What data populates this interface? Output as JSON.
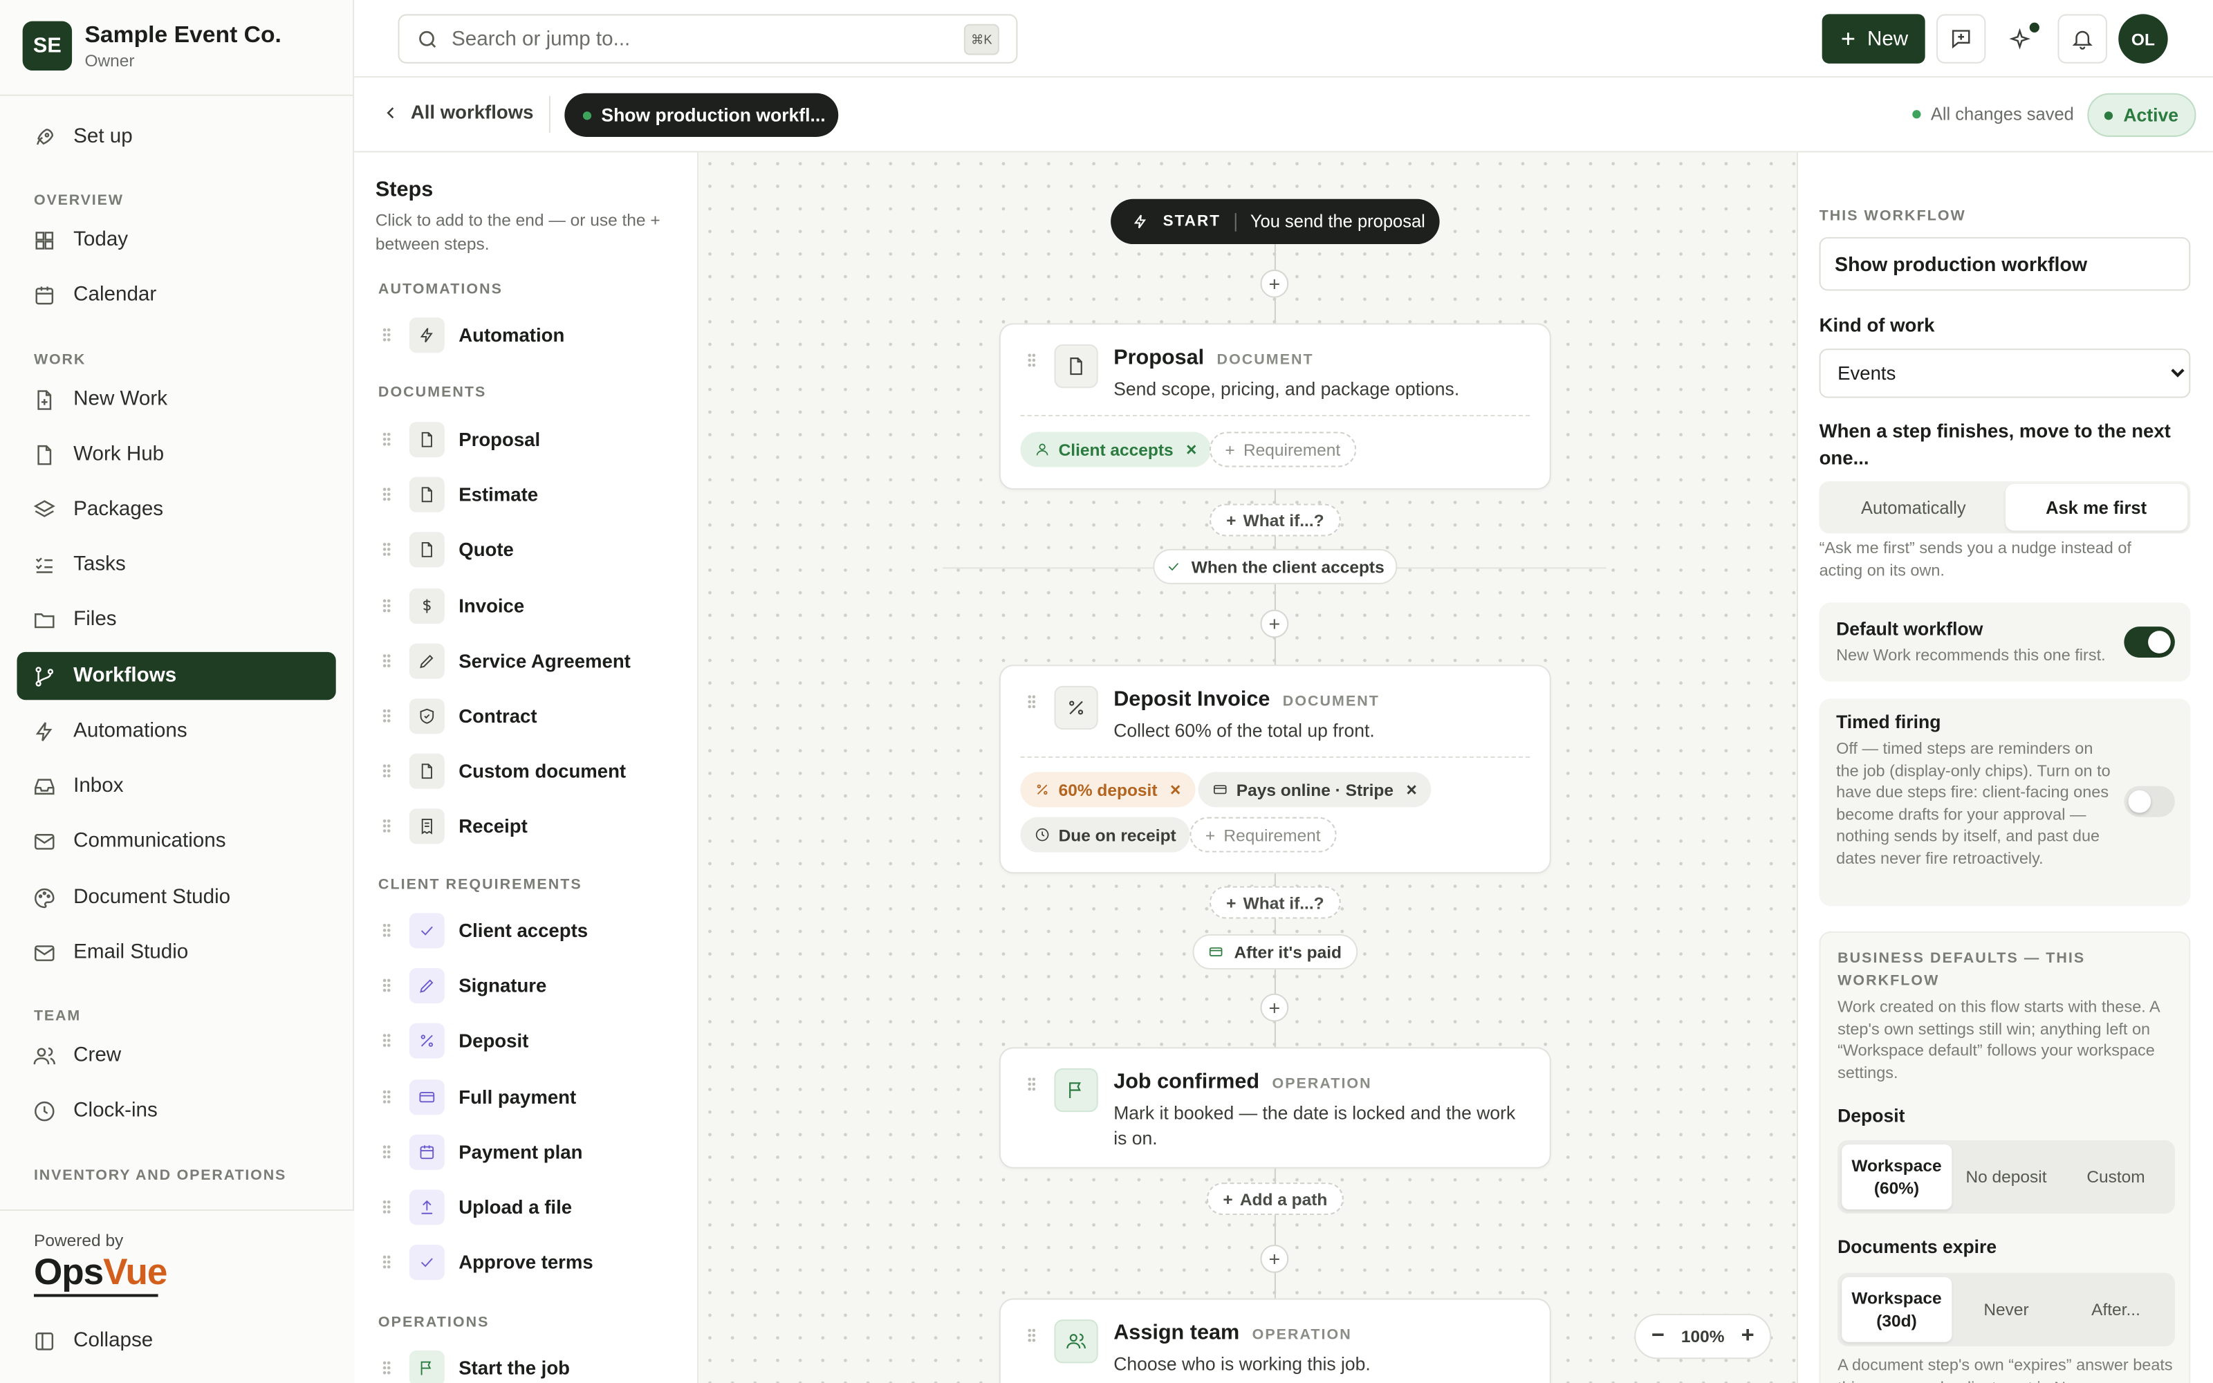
{
  "org": {
    "initials": "SE",
    "name": "Sample Event Co.",
    "role": "Owner"
  },
  "nav": {
    "setup": "Set up",
    "overview_title": "OVERVIEW",
    "today": "Today",
    "calendar": "Calendar",
    "work_title": "WORK",
    "new_work": "New Work",
    "work_hub": "Work Hub",
    "packages": "Packages",
    "tasks": "Tasks",
    "files": "Files",
    "workflows": "Workflows",
    "automations": "Automations",
    "inbox": "Inbox",
    "communications": "Communications",
    "document_studio": "Document Studio",
    "email_studio": "Email Studio",
    "team_title": "TEAM",
    "crew": "Crew",
    "clock_ins": "Clock-ins",
    "inventory_title": "INVENTORY AND OPERATIONS",
    "powered_by": "Powered by",
    "brand_ops": "Ops",
    "brand_vue": "Vue",
    "collapse": "Collapse"
  },
  "topbar": {
    "search_placeholder": "Search or jump to...",
    "shortcut": "⌘K",
    "new_label": "New",
    "avatar": "OL"
  },
  "subheader": {
    "back": "All workflows",
    "workflow_pill": "Show production workfl...",
    "saved": "All changes saved",
    "status": "Active"
  },
  "steps_panel": {
    "title": "Steps",
    "desc": "Click to add to the end — or use the + between steps.",
    "automations_title": "AUTOMATIONS",
    "automations": [
      "Automation"
    ],
    "documents_title": "DOCUMENTS",
    "documents": [
      "Proposal",
      "Estimate",
      "Quote",
      "Invoice",
      "Service Agreement",
      "Contract",
      "Custom document",
      "Receipt"
    ],
    "requirements_title": "CLIENT REQUIREMENTS",
    "requirements": [
      "Client accepts",
      "Signature",
      "Deposit",
      "Full payment",
      "Payment plan",
      "Upload a file",
      "Approve terms"
    ],
    "operations_title": "OPERATIONS",
    "operations": [
      "Start the job"
    ]
  },
  "canvas": {
    "start_label": "START",
    "start_text": "You send the proposal",
    "plus": "+",
    "requirement": "Requirement",
    "what_if": "What if...?",
    "add_path": "Add a path",
    "zoom": "100%",
    "cards": [
      {
        "title": "Proposal",
        "kind": "DOCUMENT",
        "desc": "Send scope, pricing, and package options.",
        "chips": [
          "Client accepts"
        ]
      },
      {
        "title": "Deposit Invoice",
        "kind": "DOCUMENT",
        "desc": "Collect 60% of the total up front.",
        "chips": [
          "60% deposit",
          "Pays online · Stripe",
          "Due on receipt"
        ]
      },
      {
        "title": "Job confirmed",
        "kind": "OPERATION",
        "desc": "Mark it booked — the date is locked and the work is on."
      },
      {
        "title": "Assign team",
        "kind": "OPERATION",
        "desc": "Choose who is working this job."
      }
    ],
    "conditions": [
      "When the client accepts",
      "After it's paid"
    ]
  },
  "right_panel": {
    "section": "THIS WORKFLOW",
    "name_value": "Show production workflow",
    "kind_label": "Kind of work",
    "kind_value": "Events",
    "advance_label": "When a step finishes, move to the next one...",
    "advance_options": [
      "Automatically",
      "Ask me first"
    ],
    "advance_hint": "“Ask me first” sends you a nudge instead of acting on its own.",
    "default_title": "Default workflow",
    "default_desc": "New Work recommends this one first.",
    "timed_title": "Timed firing",
    "timed_desc": "Off — timed steps are reminders on the job (display-only chips). Turn on to have due steps fire: client-facing ones become drafts for your approval — nothing sends by itself, and past due dates never fire retroactively.",
    "biz_title": "BUSINESS DEFAULTS — THIS WORKFLOW",
    "biz_desc": "Work created on this flow starts with these. A step's own settings still win; anything left on “Workspace default” follows your workspace settings.",
    "deposit_label": "Deposit",
    "deposit_options": [
      "Workspace (60%)",
      "No deposit",
      "Custom"
    ],
    "expire_label": "Documents expire",
    "expire_options": [
      "Workspace (30d)",
      "Never",
      "After..."
    ],
    "expire_hint": "A document step's own “expires” answer beats this; a per-work adjustment in New"
  },
  "colors": {
    "brand": "#1e3d22",
    "accent_orange": "#d35f1c",
    "success": "#2b7a3f"
  }
}
